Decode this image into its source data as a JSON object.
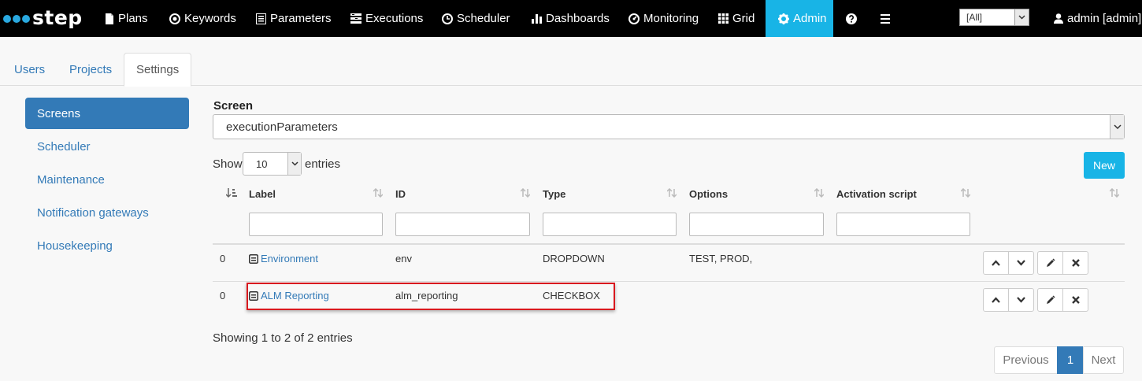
{
  "brand": {
    "name": "step"
  },
  "nav": {
    "items": [
      {
        "label": "Plans",
        "icon": "file-icon"
      },
      {
        "label": "Keywords",
        "icon": "target-icon"
      },
      {
        "label": "Parameters",
        "icon": "list-icon"
      },
      {
        "label": "Executions",
        "icon": "tasks-icon"
      },
      {
        "label": "Scheduler",
        "icon": "clock-icon"
      },
      {
        "label": "Dashboards",
        "icon": "bar-chart-icon"
      },
      {
        "label": "Monitoring",
        "icon": "dashboard-icon"
      },
      {
        "label": "Grid",
        "icon": "grid-icon"
      },
      {
        "label": "Admin",
        "icon": "gear-icon"
      }
    ],
    "active_color": "#18b4e6",
    "tenant": "[All]",
    "user": "admin [admin]"
  },
  "tabs": [
    "Users",
    "Projects",
    "Settings"
  ],
  "sidebar": [
    "Screens",
    "Scheduler",
    "Maintenance",
    "Notification gateways",
    "Housekeeping"
  ],
  "main": {
    "screen_label": "Screen",
    "screen_value": "executionParameters",
    "show_label": "Show",
    "page_length": "10",
    "entries_label": "entries",
    "new_label": "New",
    "columns": [
      "Label",
      "ID",
      "Type",
      "Options",
      "Activation script"
    ],
    "rows": [
      {
        "order": "0",
        "label": "Environment",
        "id": "env",
        "type": "DROPDOWN",
        "options": "TEST, PROD,"
      },
      {
        "order": "0",
        "label": "ALM Reporting",
        "id": "alm_reporting",
        "type": "CHECKBOX",
        "options": ""
      }
    ],
    "showing": "Showing 1 to 2 of 2 entries",
    "pager": {
      "prev": "Previous",
      "current": "1",
      "next": "Next"
    }
  }
}
